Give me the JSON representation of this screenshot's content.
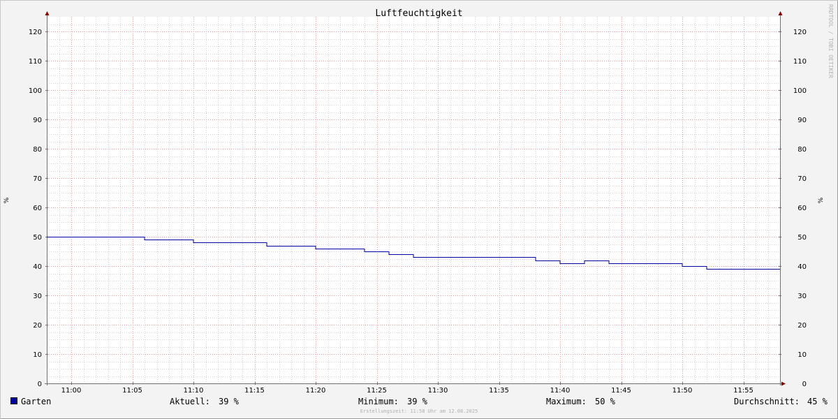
{
  "chart_data": {
    "type": "line",
    "title": "Luftfeuchtigkeit",
    "ylabel": "%",
    "ylim": [
      0,
      125
    ],
    "yticks": [
      0,
      10,
      20,
      30,
      40,
      50,
      60,
      70,
      80,
      90,
      100,
      110,
      120
    ],
    "xlim": [
      "10:58",
      "11:58"
    ],
    "xticks": [
      "11:00",
      "11:05",
      "11:10",
      "11:15",
      "11:20",
      "11:25",
      "11:30",
      "11:35",
      "11:40",
      "11:45",
      "11:50",
      "11:55"
    ],
    "grid": true,
    "step": true,
    "series": [
      {
        "name": "Garten",
        "color": "#0000a0",
        "x": [
          "10:58",
          "11:06",
          "11:10",
          "11:16",
          "11:20",
          "11:24",
          "11:26",
          "11:28",
          "11:38",
          "11:40",
          "11:42",
          "11:44",
          "11:50",
          "11:52",
          "11:58"
        ],
        "values": [
          50,
          49,
          48,
          47,
          46,
          45,
          44,
          43,
          42,
          41,
          42,
          41,
          40,
          39,
          39
        ]
      }
    ],
    "watermark": "RRDTOOL / TOBI OETIKER"
  },
  "legend": {
    "name": "Garten",
    "current_label": "Aktuell:",
    "current_value": "39 %",
    "min_label": "Minimum:",
    "min_value": "39 %",
    "max_label": "Maximum:",
    "max_value": "50 %",
    "avg_label": "Durchschnitt:",
    "avg_value": "45 %"
  },
  "footer": "Erstellungszeit: 11:58 Uhr am 12.08.2025",
  "colors": {
    "series": "#0000a0",
    "major_grid": "#e2a0a0",
    "minor_grid": "#d2d2d2",
    "axis": "#707070",
    "arrow": "#8b0000"
  }
}
